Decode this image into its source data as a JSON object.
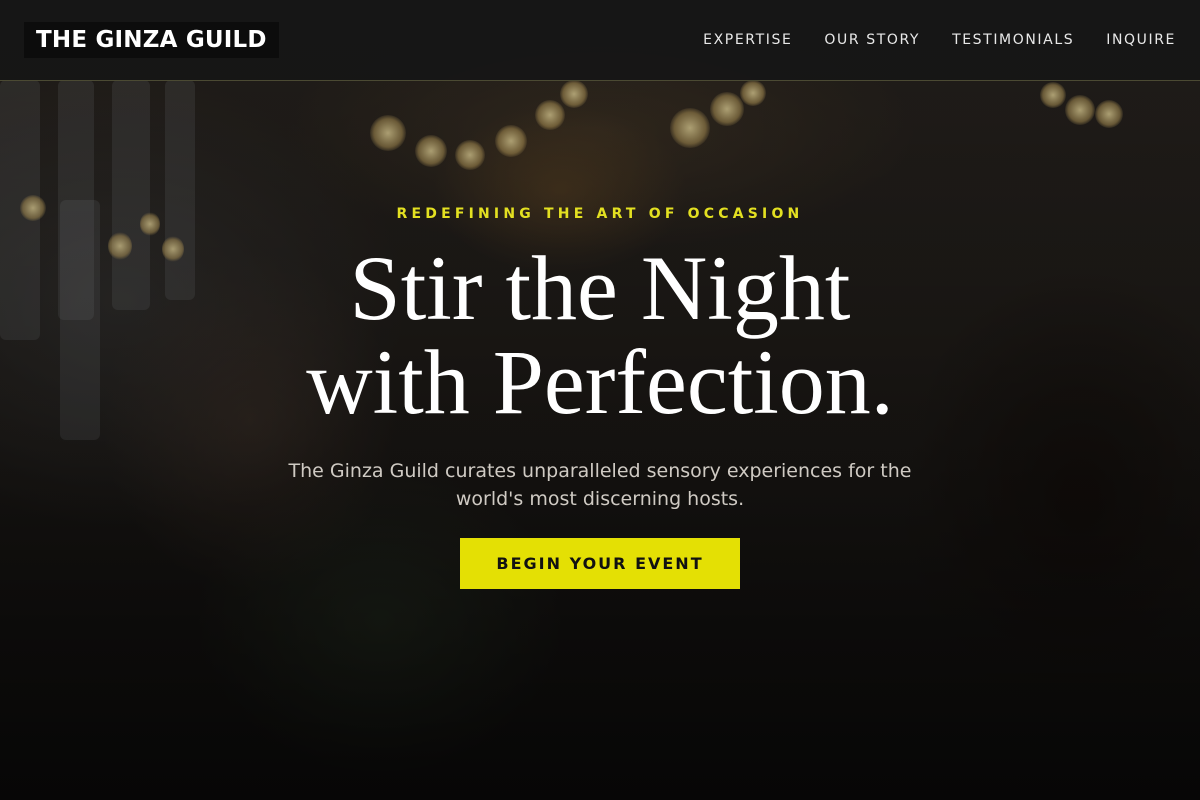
{
  "brand": {
    "name": "THE GINZA GUILD"
  },
  "nav": {
    "items": [
      {
        "label": "EXPERTISE"
      },
      {
        "label": "OUR STORY"
      },
      {
        "label": "TESTIMONIALS"
      },
      {
        "label": "INQUIRE"
      }
    ]
  },
  "hero": {
    "eyebrow": "REDEFINING THE ART OF OCCASION",
    "headline_line1": "Stir the Night",
    "headline_line2": "with Perfection.",
    "subtitle": "The Ginza Guild curates unparalleled sensory experiences for the world's most discerning hosts.",
    "cta_label": "BEGIN YOUR EVENT",
    "background_image": "blurred-celebration-toast-photo"
  },
  "colors": {
    "accent": "#e4e004",
    "eyebrow": "#e3e021",
    "nav_background": "#161616",
    "page_background": "#0e0e0e"
  }
}
